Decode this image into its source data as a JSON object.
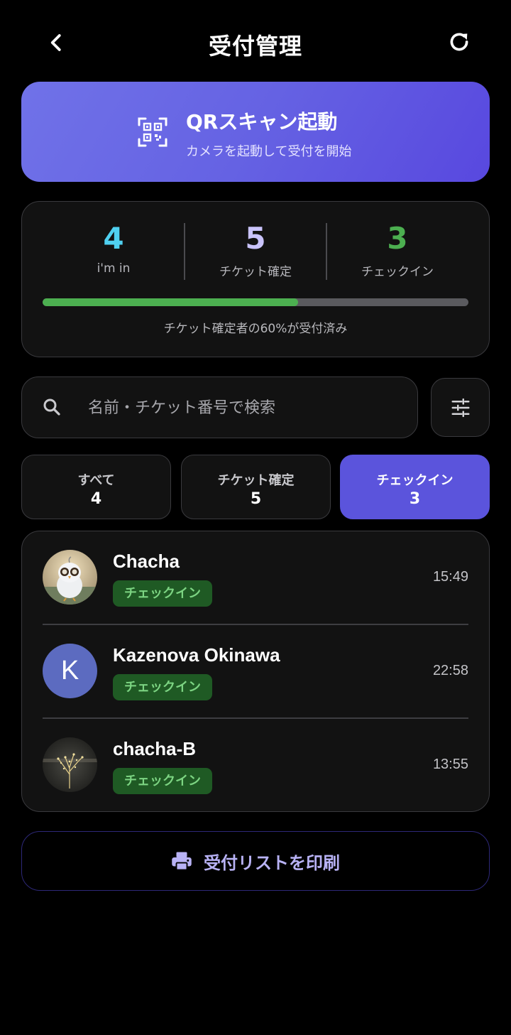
{
  "header": {
    "title": "受付管理",
    "back_icon": "chevron-left-icon",
    "refresh_icon": "refresh-icon"
  },
  "qr_card": {
    "title": "QRスキャン起動",
    "subtitle": "カメラを起動して受付を開始",
    "icon": "qr-scan-icon"
  },
  "stats": {
    "items": [
      {
        "value": "4",
        "label": "i'm in",
        "color": "#4fd0f0"
      },
      {
        "value": "5",
        "label": "チケット確定",
        "color": "#c9c3fa"
      },
      {
        "value": "3",
        "label": "チェックイン",
        "color": "#4caf50"
      }
    ],
    "progress_percent": 60,
    "progress_caption": "チケット確定者の60%が受付済み"
  },
  "search": {
    "placeholder": "名前・チケット番号で検索",
    "value": ""
  },
  "tabs": [
    {
      "label": "すべて",
      "count": "4",
      "active": false
    },
    {
      "label": "チケット確定",
      "count": "5",
      "active": false
    },
    {
      "label": "チェックイン",
      "count": "3",
      "active": true
    }
  ],
  "attendees": [
    {
      "name": "Chacha",
      "status": "チェックイン",
      "time": "15:49",
      "avatar": "bird-photo"
    },
    {
      "name": "Kazenova Okinawa",
      "status": "チェックイン",
      "time": "22:58",
      "avatar_letter": "K"
    },
    {
      "name": "chacha-B",
      "status": "チェックイン",
      "time": "13:55",
      "avatar": "tree-photo"
    }
  ],
  "print_button": {
    "label": "受付リストを印刷",
    "icon": "printer-icon"
  },
  "colors": {
    "accent": "#5b54dc",
    "success": "#4caf50",
    "badge_bg": "#1f5a24",
    "badge_text": "#7cd482"
  }
}
